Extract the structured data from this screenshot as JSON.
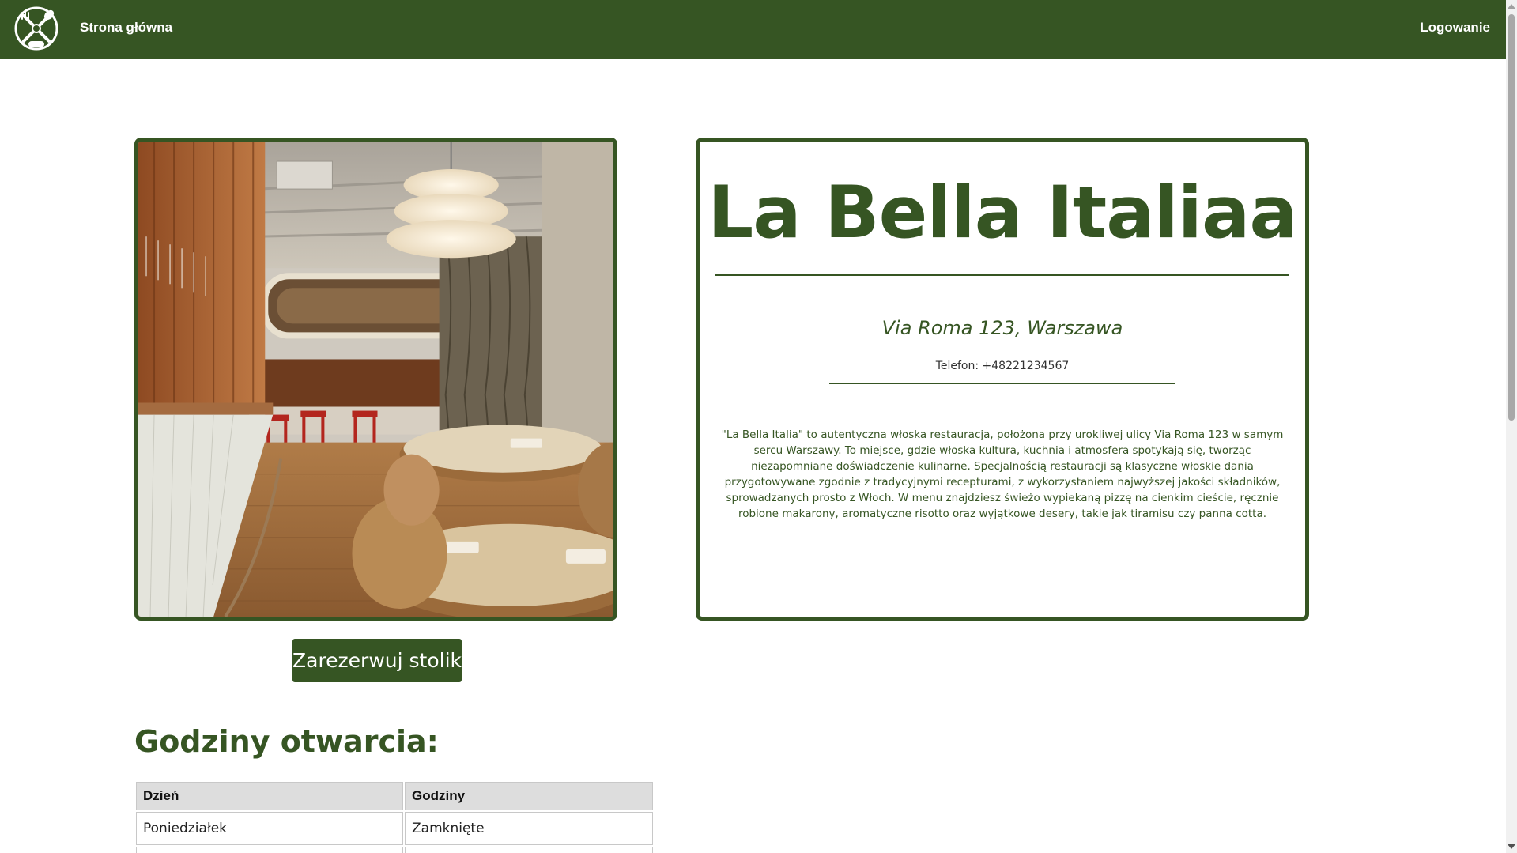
{
  "navbar": {
    "home_label": "Strona główna",
    "login_label": "Logowanie",
    "logo_icon": "crossed-utensils-logo-icon",
    "color": "#365523"
  },
  "hero": {
    "photo_alt": "Restaurant interior",
    "reserve_label": "Zarezerwuj stolik"
  },
  "info": {
    "name": "La Bella Italiaa",
    "address": "Via Roma 123, Warszawa",
    "phone": "Telefon: +48221234567",
    "description": "\"La Bella Italia\" to autentyczna włoska restauracja, położona przy urokliwej ulicy Via Roma 123 w samym sercu Warszawy. To miejsce, gdzie włoska kultura, kuchnia i atmosfera spotykają się, tworząc niezapomniane doświadczenie kulinarne. Specjalnością restauracji są klasyczne włoskie dania przygotowywane zgodnie z tradycyjnymi recepturami, z wykorzystaniem najwyższej jakości składników, sprowadzanych prosto z Włoch. W menu znajdziesz świeżo wypiekaną pizzę na cienkim cieście, ręcznie robione makarony, aromatyczne risotto oraz wyjątkowe desery, takie jak tiramisu czy panna cotta."
  },
  "hours": {
    "title": "Godziny otwarcia:",
    "headers": [
      "Dzień",
      "Godziny"
    ],
    "rows": [
      [
        "Poniedziałek",
        "Zamknięte"
      ],
      [
        "",
        ""
      ]
    ]
  },
  "colors": {
    "brand_green": "#365523",
    "header_bg": "#dddddd"
  }
}
